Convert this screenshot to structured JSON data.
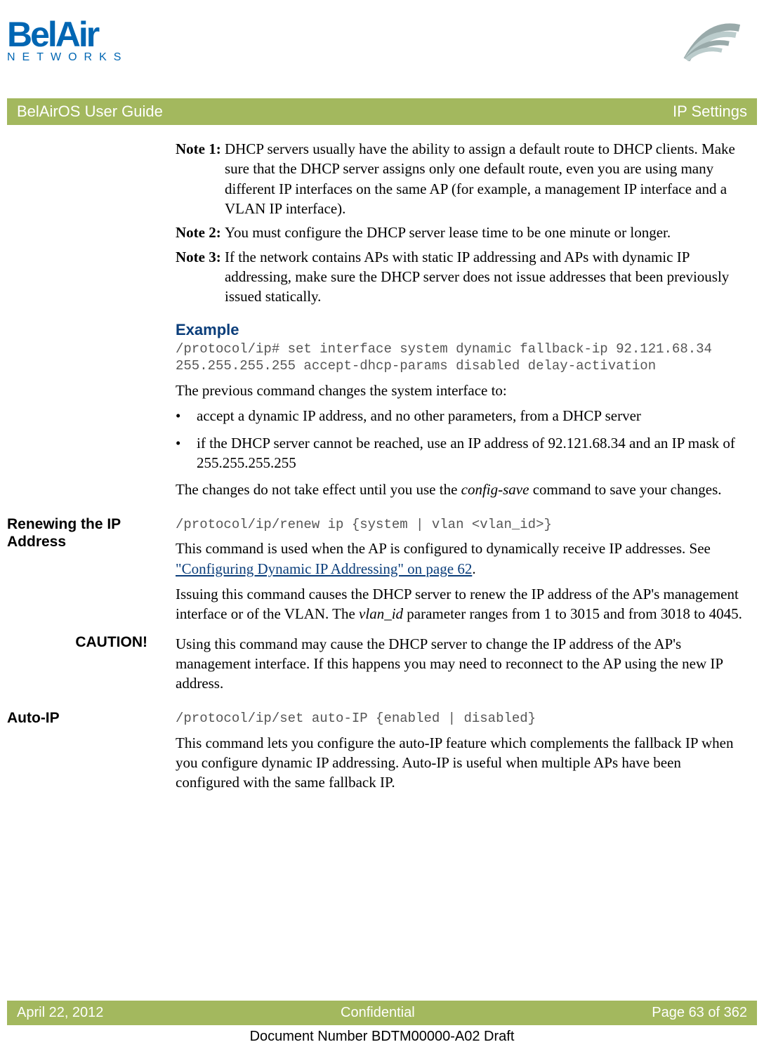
{
  "logo": {
    "main": "BelAir",
    "sub": "NETWORKS"
  },
  "title_bar": {
    "left": "BelAirOS User Guide",
    "right": "IP Settings"
  },
  "notes": {
    "note1_label": "Note 1:",
    "note1_body": "DHCP servers usually have the ability to assign a default route to DHCP clients. Make sure that the DHCP server assigns only one default route, even you are using many different IP interfaces on the same AP (for example, a management IP interface and a VLAN IP interface).",
    "note2_label": "Note 2:",
    "note2_body": "You must configure the DHCP server lease time to be one minute or longer.",
    "note3_label": "Note 3:",
    "note3_body": "If the network contains APs with static IP addressing and APs with dynamic IP addressing, make sure the DHCP server does not issue addresses that been previously issued statically."
  },
  "example": {
    "heading": "Example",
    "code": "/protocol/ip# set interface system dynamic fallback-ip 92.121.68.34 255.255.255.255 accept-dhcp-params disabled delay-activation",
    "intro": "The previous command changes the system interface to:",
    "bullet1": "accept a dynamic IP address, and no other parameters, from a DHCP server",
    "bullet2": "if the DHCP server cannot be reached, use an IP address of 92.121.68.34 and an IP mask of 255.255.255.255",
    "outro_a": "The changes do not take effect until you use the ",
    "outro_cmd": "config-save",
    "outro_b": " command to save your changes."
  },
  "renew": {
    "heading": "Renewing the IP Address",
    "code": "/protocol/ip/renew ip {system | vlan <vlan_id>}",
    "p1a": "This command is used when the AP is configured to dynamically receive IP addresses. See ",
    "p1link": "\"Configuring Dynamic IP Addressing\" on page 62",
    "p1b": ".",
    "p2a": "Issuing this command causes the DHCP server to renew the IP address of the AP's management interface or of the VLAN. The ",
    "p2_param": "vlan_id",
    "p2b": " parameter ranges from 1 to 3015 and from 3018 to 4045."
  },
  "caution": {
    "label": "CAUTION!",
    "body": "Using this command may cause the DHCP server to change the IP address of the AP's management interface. If this happens you may need to reconnect to the AP using the new IP address."
  },
  "autoip": {
    "heading": "Auto-IP",
    "code": "/protocol/ip/set auto-IP {enabled | disabled}",
    "body": "This command lets you configure the auto-IP feature which complements the fallback IP when you configure dynamic IP addressing. Auto-IP is useful when multiple APs have been configured with the same fallback IP."
  },
  "footer": {
    "left": "April 22, 2012",
    "center": "Confidential",
    "right": "Page 63 of 362"
  },
  "doc_number": "Document Number BDTM00000-A02 Draft"
}
